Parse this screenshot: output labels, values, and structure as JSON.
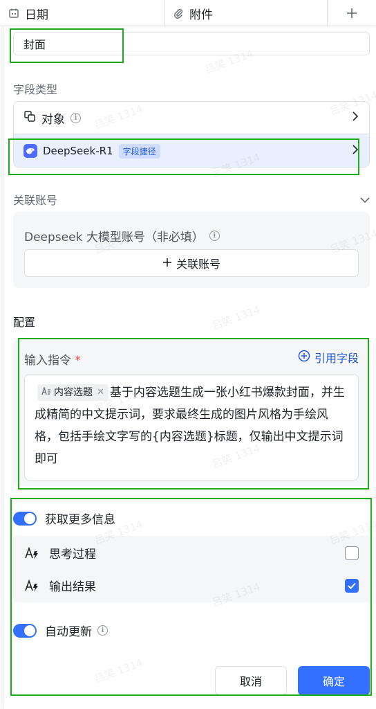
{
  "table_header": {
    "date_label": "日期",
    "attach_label": "附件",
    "add_icon": "plus-icon"
  },
  "field": {
    "name_value": "封面",
    "type_section_label": "字段类型",
    "type_object_label": "对象",
    "type_deepseek_label": "DeepSeek-R1",
    "type_deepseek_tag": "字段捷径"
  },
  "account": {
    "section_label": "关联账号",
    "box_title": "Deepseek 大模型账号（非必填）",
    "link_button_label": "关联账号"
  },
  "config": {
    "section_label": "配置",
    "command_label": "输入指令",
    "required_mark": "*",
    "ref_field_label": "引用字段",
    "chip_label": "内容选题",
    "prompt_text": "基于内容选题生成一张小红书爆款封面，并生成精简的中文提示词，要求最终生成的图片风格为手绘风格，包括手绘文字写的{内容选题}标题，仅输出中文提示词即可"
  },
  "more_info": {
    "toggle_label": "获取更多信息",
    "toggle_on": true,
    "items": [
      {
        "label": "思考过程",
        "checked": false
      },
      {
        "label": "输出结果",
        "checked": true
      }
    ]
  },
  "auto_update": {
    "toggle_label": "自动更新",
    "toggle_on": true
  },
  "footer": {
    "cancel_label": "取消",
    "confirm_label": "确定"
  },
  "watermark": "吕笑 1314",
  "colors": {
    "accent": "#3370ff",
    "selected_bg": "#e8effd",
    "highlight_border": "#1aad19",
    "required": "#f54a45"
  }
}
